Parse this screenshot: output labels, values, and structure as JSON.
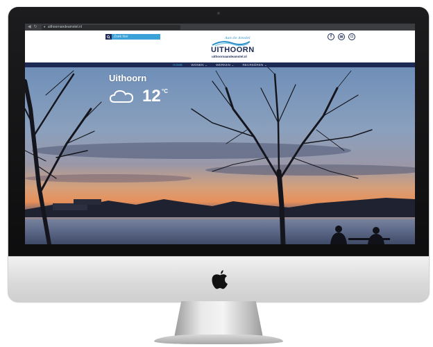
{
  "browser": {
    "url": "uithoornandeamstel.nl"
  },
  "header": {
    "search_placeholder": "Zoek hier",
    "logo": {
      "tagline": "Aan de Amstel",
      "name": "UITHOORN",
      "url": "uithoornaandeamstel.nl"
    },
    "social": [
      {
        "icon": "facebook-icon",
        "glyph": "f"
      },
      {
        "icon": "mail-icon",
        "glyph": "✉"
      },
      {
        "icon": "camera-icon",
        "glyph": "◘"
      }
    ]
  },
  "nav": {
    "items": [
      {
        "label": "HOME",
        "active": true
      },
      {
        "label": "WONEN ⌄",
        "active": false
      },
      {
        "label": "WERKEN ⌄",
        "active": false
      },
      {
        "label": "RECREËREN ⌄",
        "active": false
      }
    ]
  },
  "weather": {
    "city": "Uithoorn",
    "temperature": "12",
    "unit": "°C",
    "condition_icon": "cloud-icon"
  },
  "colors": {
    "navy": "#1c2a54",
    "accent": "#3aa2d8"
  }
}
